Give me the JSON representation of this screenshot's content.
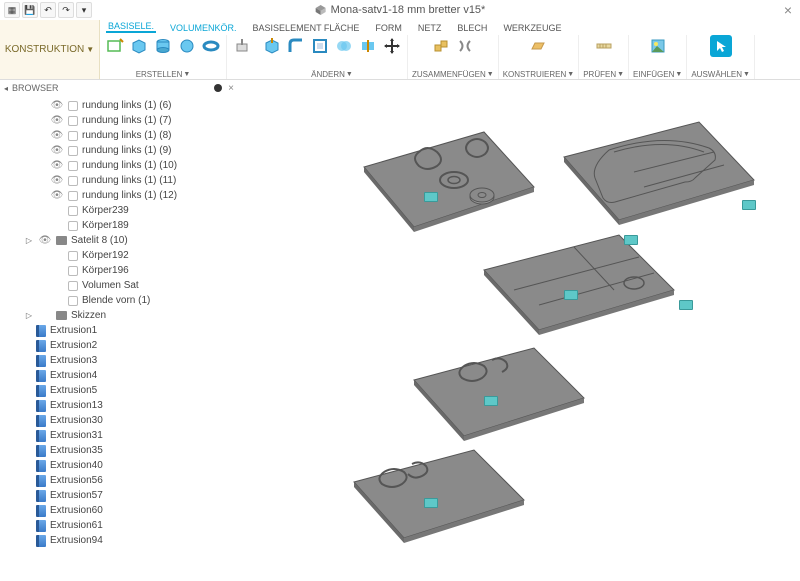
{
  "title": "Mona-satv1-18 mm bretter v15*",
  "construction_label": "KONSTRUKTION",
  "ribbon": {
    "tabs": [
      "BASISELE.",
      "VOLUMENKÖR.",
      "BASISELEMENT FLÄCHE",
      "FORM",
      "NETZ",
      "BLECH",
      "WERKZEUGE"
    ],
    "groups": {
      "erstellen": "ERSTELLEN",
      "aendern": "ÄNDERN",
      "zusammen": "ZUSAMMENFÜGEN",
      "konstr": "KONSTRUIEREN",
      "pruefen": "PRÜFEN",
      "einfuegen": "EINFÜGEN",
      "auswaehlen": "AUSWÄHLEN"
    }
  },
  "browser": {
    "header": "BROWSER",
    "items_top": [
      "rundung links (1) (6)",
      "rundung links (1) (7)",
      "rundung links (1) (8)",
      "rundung links (1) (9)",
      "rundung links (1) (10)",
      "rundung links (1) (11)",
      "rundung links (1) (12)",
      "Körper239",
      "Körper189"
    ],
    "satelit": "Satelit 8 (10)",
    "items_mid": [
      "Körper192",
      "Körper196",
      "Volumen Sat",
      "Blende vorn (1)"
    ],
    "skizzen": "Skizzen",
    "extrusions": [
      "Extrusion1",
      "Extrusion2",
      "Extrusion3",
      "Extrusion4",
      "Extrusion5",
      "Extrusion13",
      "Extrusion30",
      "Extrusion31",
      "Extrusion35",
      "Extrusion40",
      "Extrusion56",
      "Extrusion57",
      "Extrusion60",
      "Extrusion61",
      "Extrusion94"
    ]
  }
}
